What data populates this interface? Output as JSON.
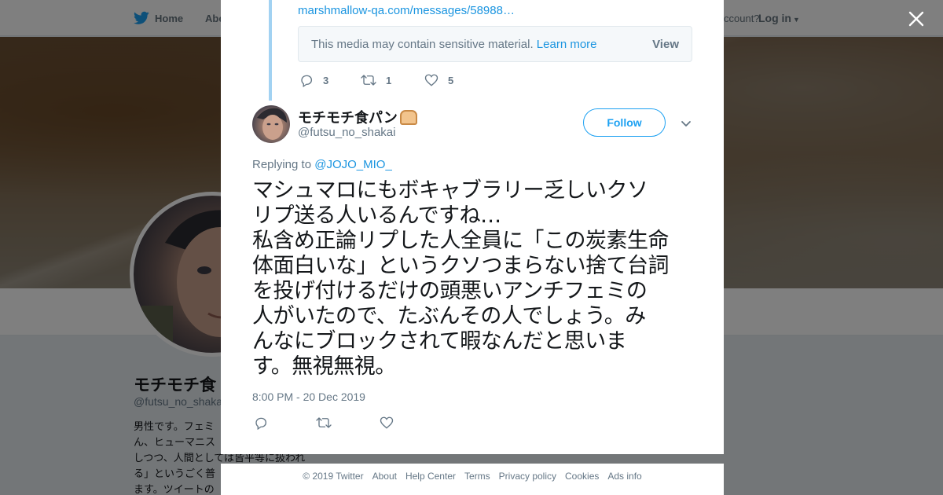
{
  "topnav": {
    "home_label": "Home",
    "about_label": "Abo",
    "account_prompt": "ccount?",
    "login_label": "Log in"
  },
  "profile_bg": {
    "name": "モチモチ食",
    "handle": "@futsu_no_shaka",
    "bio_lines": [
      "男性です。フェミ",
      "ん、ヒューマニス",
      "しつつ、人間としては皆平等に扱われ",
      "る」というごく普",
      "ます。ツイートの"
    ]
  },
  "previous_tweet": {
    "link_text": "marshmallow-qa.com/messages/58988…",
    "media_warning": "This media may contain sensitive material.",
    "learn_more_label": "Learn more",
    "view_label": "View",
    "reply_count": "3",
    "retweet_count": "1",
    "like_count": "5"
  },
  "tweet": {
    "author_name": "モチモチ食パン",
    "author_emoji": "bread-emoji",
    "handle": "@futsu_no_shakai",
    "follow_label": "Follow",
    "replying_prefix": "Replying to",
    "replying_handle": "@JOJO_MIO_",
    "text": "マシュマロにもボキャブラリー乏しいクソ\nリプ送る人いるんですね…\n私含め正論リプした人全員に「この炭素生命\n体面白いな」というクソつまらない捨て台詞\nを投げ付けるだけの頭悪いアンチフェミの\n人がいたので、たぶんその人でしょう。み\nんなにブロックされて暇なんだと思いま\nす。無視無視。",
    "timestamp": "8:00 PM - 20 Dec 2019"
  },
  "footer": {
    "links": [
      "© 2019 Twitter",
      "About",
      "Help Center",
      "Terms",
      "Privacy policy",
      "Cookies",
      "Ads info"
    ]
  },
  "colors": {
    "twitter_blue": "#1da1f2",
    "link_blue": "#1b95e0",
    "muted_gray": "#657786",
    "thread_line": "#a2d2f2"
  },
  "icons": {
    "logo": "twitter-bird-icon",
    "close": "close-icon",
    "reply": "reply-icon",
    "retweet": "retweet-icon",
    "like": "heart-icon",
    "more": "chevron-down-icon"
  }
}
